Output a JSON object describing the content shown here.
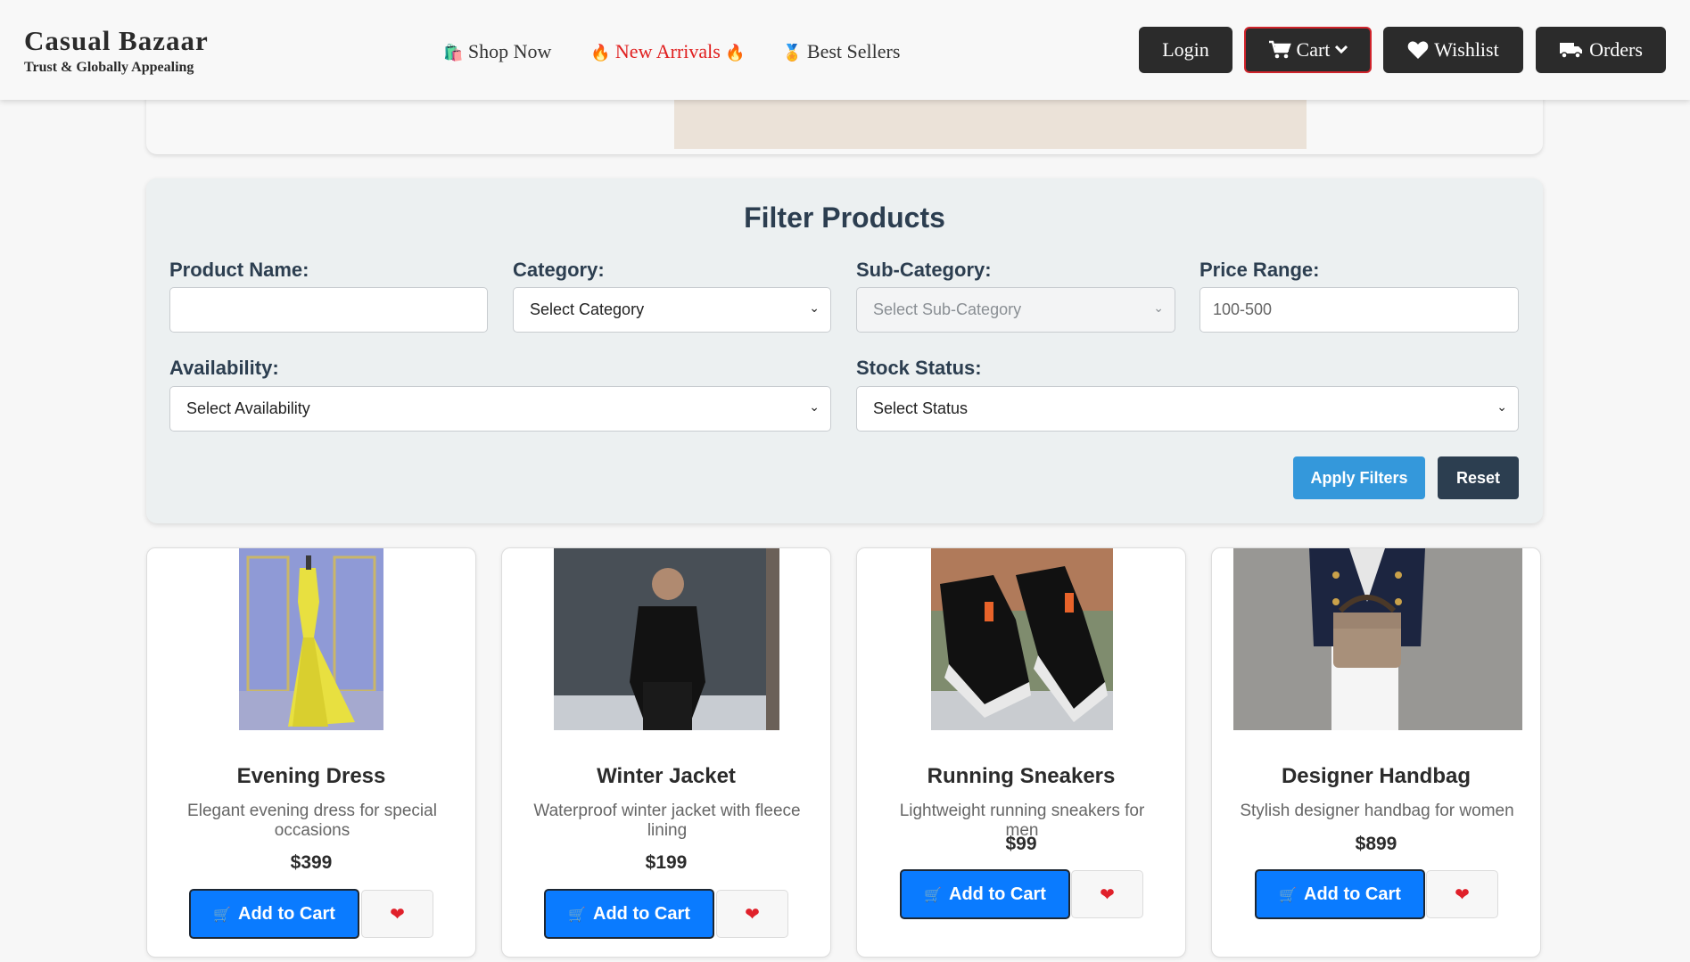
{
  "header": {
    "brand_title": "Casual Bazaar",
    "brand_tagline": "Trust & Globally Appealing",
    "nav": {
      "shop_now": {
        "icon": "🛍️",
        "label": "Shop Now"
      },
      "new_arrivals": {
        "icon_left": "🔥",
        "label": "New Arrivals",
        "icon_right": "🔥",
        "color": "#e02020"
      },
      "best_sellers": {
        "icon": "🏅",
        "label": "Best Sellers"
      }
    },
    "buttons": {
      "login": "Login",
      "cart": "Cart",
      "wishlist": "Wishlist",
      "orders": "Orders"
    }
  },
  "filter": {
    "title": "Filter Products",
    "product_name_label": "Product Name:",
    "product_name_value": "",
    "category_label": "Category:",
    "category_value": "Select Category",
    "subcategory_label": "Sub-Category:",
    "subcategory_value": "Select Sub-Category",
    "price_label": "Price Range:",
    "price_placeholder": "100-500",
    "availability_label": "Availability:",
    "availability_value": "Select Availability",
    "stock_label": "Stock Status:",
    "stock_value": "Select Status",
    "apply_label": "Apply Filters",
    "reset_label": "Reset"
  },
  "products": [
    {
      "name": "Evening Dress",
      "description": "Elegant evening dress for special occasions",
      "price": "$399",
      "add_label": "Add to Cart"
    },
    {
      "name": "Winter Jacket",
      "description": "Waterproof winter jacket with fleece lining",
      "price": "$199",
      "add_label": "Add to Cart"
    },
    {
      "name": "Running Sneakers",
      "description": "Lightweight running sneakers for men",
      "price": "$99",
      "add_label": "Add to Cart"
    },
    {
      "name": "Designer Handbag",
      "description": "Stylish designer handbag for women",
      "price": "$899",
      "add_label": "Add to Cart"
    }
  ],
  "colors": {
    "primary_button": "#0a7bff",
    "apply_button": "#3498db",
    "reset_button": "#2c3e50",
    "header_button": "#2b2b2b",
    "heart": "#e0202a"
  }
}
